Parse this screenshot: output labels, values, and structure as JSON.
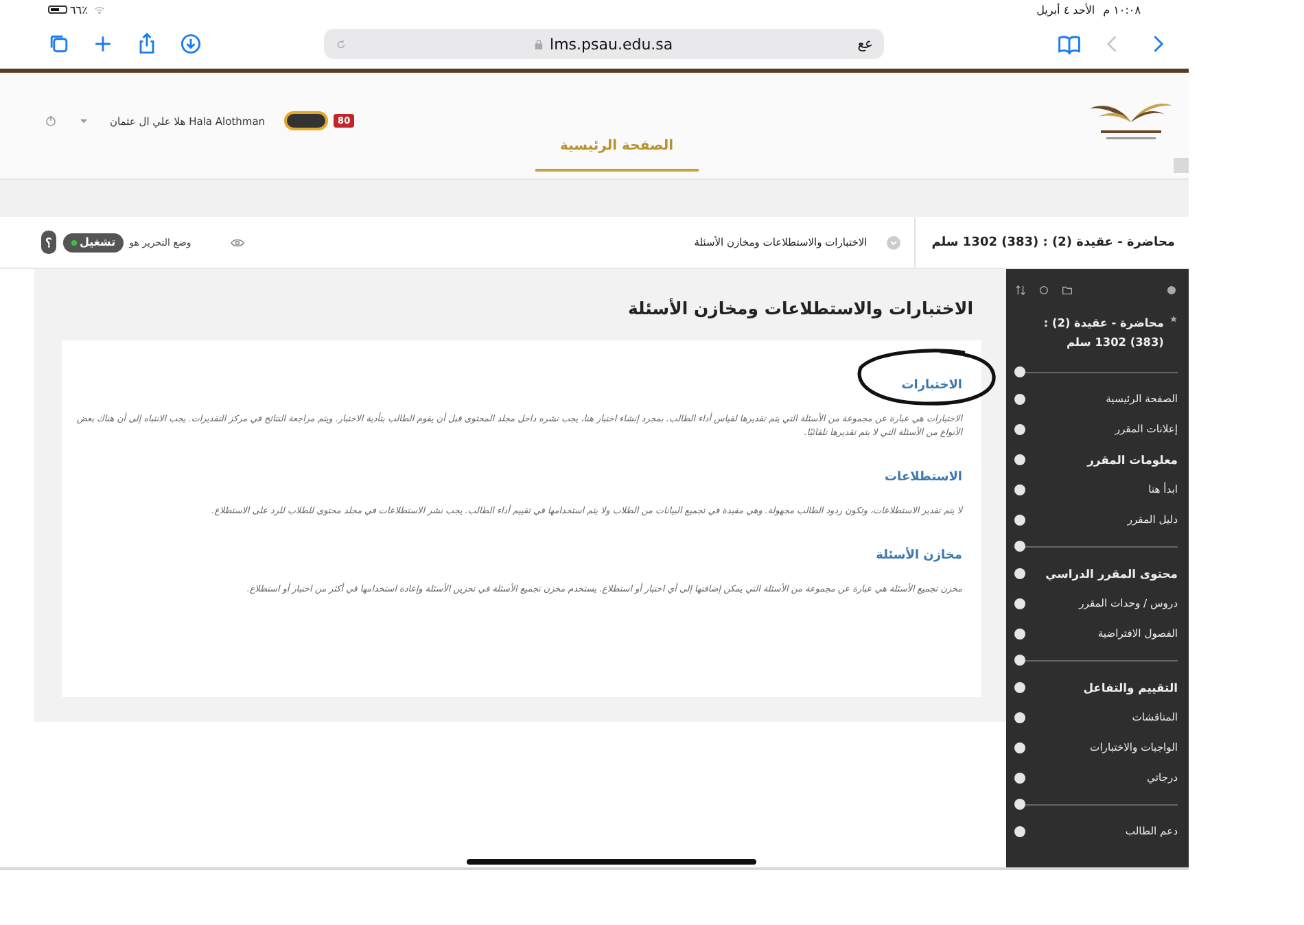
{
  "status_bar": {
    "time": "١٠:٠٨ م",
    "date": "الأحد ٤ أبريل",
    "battery": "٦٦٪"
  },
  "browser": {
    "url": "lms.psau.edu.sa",
    "text_size": "عع"
  },
  "header": {
    "badge": "80",
    "user_name": "هلا علي ال عثمان Hala Alothman",
    "tabs": [
      {
        "label": "الصفحة الرئيسية",
        "selected": true
      }
    ]
  },
  "breadcrumb": {
    "course": "محاضرة - عقيدة (2) : (383) 1302 سلم",
    "page": "الاختبارات والاستطلاعات ومخازن الأسئلة"
  },
  "edit_mode": {
    "label": "وضع التحرير هو",
    "state": "تشغيل",
    "on": true
  },
  "help": "؟",
  "content": {
    "title": "الاختبارات والاستطلاعات ومخازن الأسئلة",
    "sections": [
      {
        "heading": "الاختبارات",
        "circled": true,
        "text": "الاختبارات هي عبارة عن مجموعة من الأسئلة التي يتم تقديرها لقياس أداء الطالب. بمجرد إنشاء اختبار هنا، يجب نشره داخل مجلد المحتوى قبل أن يقوم الطالب بتأدية الاختبار. ويتم مراجعة النتائج في مركز التقديرات. يجب الانتباه إلى أن هناك بعض الأنواع من الأسئلة التي لا يتم تقديرها تلقائيًا."
      },
      {
        "heading": "الاستطلاعات",
        "circled": false,
        "text": "لا يتم تقدير الاستطلاعات، وتكون ردود الطالب مجهولة. وهي مفيدة في تجميع البيانات من الطلاب ولا يتم استخدامها في تقييم أداء الطالب. يجب نشر الاستطلاعات في مجلد محتوى للطلاب للرد على الاستطلاع."
      },
      {
        "heading": "مخازن الأسئلة",
        "circled": false,
        "text": "مخزن تجميع الأسئلة هي عبارة عن مجموعة من الأسئلة التي يمكن إضافتها إلى أي اختبار أو استطلاع. يستخدم مخزن تجميع الأسئلة في تخزين الأسئلة وإعادة استخدامها في أكثر من اختبار أو استطلاع."
      }
    ]
  },
  "sidebar": {
    "course_title": "محاضرة - عقيدة (2) : (383) 1302 سلم",
    "items": [
      {
        "kind": "divider"
      },
      {
        "kind": "link",
        "label": "الصفحة الرئيسية"
      },
      {
        "kind": "link",
        "label": "إعلانات المقرر"
      },
      {
        "kind": "header",
        "label": "معلومات المقرر"
      },
      {
        "kind": "link",
        "label": "ابدأ هنا"
      },
      {
        "kind": "link",
        "label": "دليل المقرر"
      },
      {
        "kind": "divider"
      },
      {
        "kind": "header",
        "label": "محتوى المقرر الدراسي"
      },
      {
        "kind": "link",
        "label": "دروس / وحدات المقرر"
      },
      {
        "kind": "link",
        "label": "الفصول الافتراضية"
      },
      {
        "kind": "divider"
      },
      {
        "kind": "header",
        "label": "التقييم والتفاعل"
      },
      {
        "kind": "link",
        "label": "المناقشات"
      },
      {
        "kind": "link",
        "label": "الواجبات والاختبارات"
      },
      {
        "kind": "link",
        "label": "درجاتي"
      },
      {
        "kind": "divider"
      },
      {
        "kind": "link",
        "label": "دعم الطالب"
      }
    ]
  }
}
